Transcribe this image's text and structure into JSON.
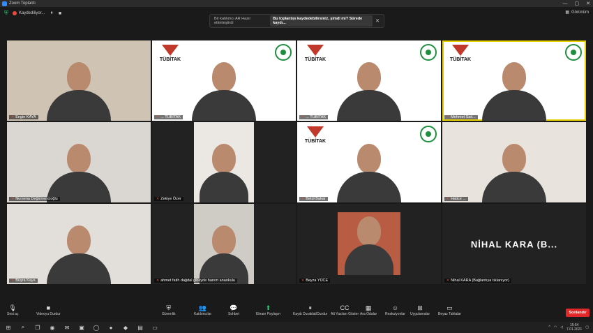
{
  "window": {
    "title": "Zoom Toplantı",
    "controls": [
      "—",
      "▢",
      "✕"
    ]
  },
  "topbar": {
    "record_label": "Kaydediliyor...",
    "pause": "⏸",
    "stop": "■",
    "view_label": "Görünüm"
  },
  "notice": {
    "prefix": "Bir katılımcı AR Hazır etkinleştirdi",
    "chip": "Bu toplantıyı kaydedebilirsiniz, şimdi mi? Sürede kaydı...",
    "close": "✕"
  },
  "tiles": [
    {
      "name": "Engin KAYA",
      "kind": "video",
      "bg": "#cfc4b3"
    },
    {
      "name": "... TÜBİTAK",
      "kind": "tubitak",
      "bg": "#ffffff",
      "logo_text": "TÜBİTAK"
    },
    {
      "name": "... TÜBİTAK",
      "kind": "tubitak",
      "bg": "#ffffff",
      "logo_text": "TÜBİTAK"
    },
    {
      "name": "Mehmet Sait...",
      "kind": "tubitak",
      "bg": "#ffffff",
      "logo_text": "TÜBİTAK",
      "active": true
    },
    {
      "name": "Nursena Değirmencioğlu",
      "kind": "video",
      "bg": "#dad6d2"
    },
    {
      "name": "Zekiye Özer",
      "kind": "portrait",
      "bg": "#ebe8e4"
    },
    {
      "name": "Betül Bakar",
      "kind": "tubitak",
      "bg": "#ffffff",
      "logo_text": "TÜBİTAK"
    },
    {
      "name": "Hatice ...",
      "kind": "video",
      "bg": "#e8e4dd"
    },
    {
      "name": "Büşra Kaya",
      "kind": "video",
      "bg": "#e2ded9"
    },
    {
      "name": "ahmet fatih dağdal gibeyde hanım anaokulu",
      "kind": "portrait",
      "bg": "#cfcbc5"
    },
    {
      "name": "Beyza YÜCE",
      "kind": "portrait-small",
      "bg": "#b85c43"
    },
    {
      "name": "Nihal KARA (Bağlantıya tıklanıyor)",
      "kind": "text",
      "bg": "#222222",
      "big_text": "NİHAL KARA (B..."
    }
  ],
  "toolbar": {
    "items": [
      {
        "label": "Sesi aç",
        "icon": "mic-icon",
        "glyph": "🎙"
      },
      {
        "label": "Videoyu Durdur",
        "icon": "video-icon",
        "glyph": "■"
      },
      {
        "label": "Güvenlik",
        "icon": "shield-icon",
        "glyph": "⛨"
      },
      {
        "label": "Katılımcılar",
        "icon": "participants-icon",
        "glyph": "👥"
      },
      {
        "label": "Sohbet",
        "icon": "chat-icon",
        "glyph": "💬"
      },
      {
        "label": "Ekranı Paylaşın",
        "icon": "share-screen-icon",
        "glyph": "⬆"
      },
      {
        "label": "Kaydı Duraklat/Durdur",
        "icon": "record-icon",
        "glyph": "⏸"
      },
      {
        "label": "Alt Yazıları Göster",
        "icon": "cc-icon",
        "glyph": "CC"
      },
      {
        "label": "Ara Odalar",
        "icon": "breakout-icon",
        "glyph": "▦"
      },
      {
        "label": "Reaksiyonlar",
        "icon": "reactions-icon",
        "glyph": "☺"
      },
      {
        "label": "Uygulamalar",
        "icon": "apps-icon",
        "glyph": "⊞"
      },
      {
        "label": "Beyaz Tahtalar",
        "icon": "whiteboard-icon",
        "glyph": "▭"
      }
    ],
    "end_label": "Sonlandır"
  },
  "taskbar": {
    "time": "15:54",
    "date": "7.01.2021"
  },
  "colors": {
    "accent": "#2d8cff",
    "end": "#e02828",
    "active_speaker": "#e8d000",
    "green": "#2ecc71"
  }
}
